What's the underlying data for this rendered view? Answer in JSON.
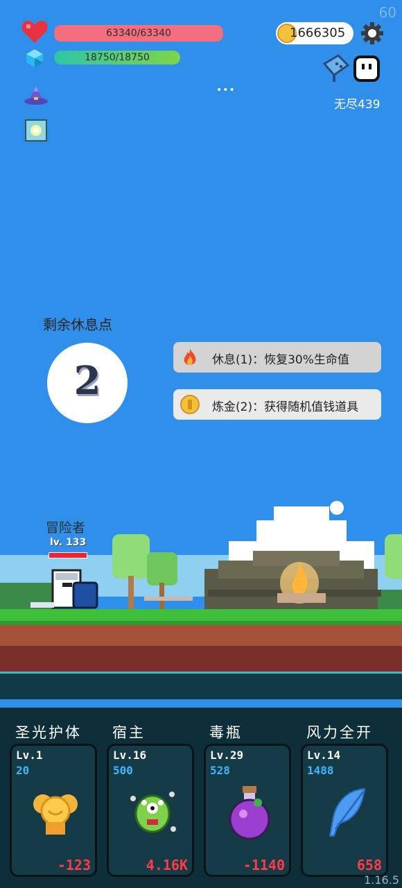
{
  "hud": {
    "fps": "60",
    "hp_text": "63340/63340",
    "mp_text": "18750/18750",
    "coins": "1666305",
    "endless_label": "无尽439",
    "more_label": "•••",
    "version": "1.16.5"
  },
  "rest": {
    "title": "剩余休息点",
    "count": "2",
    "options": [
      {
        "label": "休息(1)：恢复30%生命值",
        "icon": "fire-icon"
      },
      {
        "label": "炼金(2)：获得随机值钱道具",
        "icon": "gold-coin-icon"
      }
    ]
  },
  "hero": {
    "name": "冒险者",
    "level": "lv. 133"
  },
  "skills": [
    {
      "name": "圣光护体",
      "level": "Lv.1",
      "cost": "20",
      "value": "-123",
      "icon": "holy-shield-icon"
    },
    {
      "name": "宿主",
      "level": "Lv.16",
      "cost": "500",
      "value": "4.16K",
      "icon": "green-monster-icon"
    },
    {
      "name": "毒瓶",
      "level": "Lv.29",
      "cost": "528",
      "value": "-1140",
      "icon": "poison-bottle-icon"
    },
    {
      "name": "风力全开",
      "level": "Lv.14",
      "cost": "1488",
      "value": "658",
      "icon": "blue-feather-icon"
    }
  ],
  "colors": {
    "sky": "#2f8fea",
    "hp_bar": "#f36f7f",
    "mp_bar": "#2fc5a7",
    "panel": "#0e2f3a",
    "cost_text": "#3fb6ff",
    "value_text": "#ff3b49"
  }
}
